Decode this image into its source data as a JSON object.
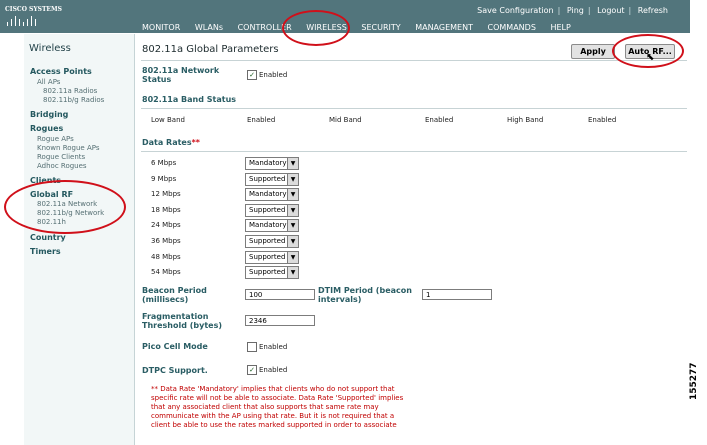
{
  "header": {
    "logo_text": "CISCO SYSTEMS",
    "util_links": [
      "Save Configuration",
      "Ping",
      "Logout",
      "Refresh"
    ],
    "nav": [
      "MONITOR",
      "WLANs",
      "CONTROLLER",
      "WIRELESS",
      "SECURITY",
      "MANAGEMENT",
      "COMMANDS",
      "HELP"
    ]
  },
  "sidebar": {
    "title": "Wireless",
    "access_points": "Access Points",
    "all_aps": "All APs",
    "radios_a": "802.11a Radios",
    "radios_bg": "802.11b/g Radios",
    "bridging": "Bridging",
    "rogues": "Rogues",
    "rogue_aps": "Rogue APs",
    "known_rogue_aps": "Known Rogue APs",
    "rogue_clients": "Rogue Clients",
    "adhoc_rogues": "Adhoc Rogues",
    "clients": "Clients",
    "global_rf": "Global RF",
    "net_a": "802.11a Network",
    "net_bg": "802.11b/g Network",
    "net_h": "802.11h",
    "country": "Country",
    "timers": "Timers"
  },
  "main": {
    "title": "802.11a Global Parameters",
    "apply": "Apply",
    "auto_rf": "Auto RF...",
    "network_status_label": "802.11a Network Status",
    "network_status_enabled": "Enabled",
    "band_status_label": "802.11a Band Status",
    "low_band": "Low Band",
    "low_band_val": "Enabled",
    "mid_band": "Mid Band",
    "mid_band_val": "Enabled",
    "high_band": "High Band",
    "high_band_val": "Enabled",
    "data_rates_label": "Data Rates",
    "data_rates_mark": "**",
    "rates": [
      {
        "rate": "6 Mbps",
        "value": "Mandatory"
      },
      {
        "rate": "9 Mbps",
        "value": "Supported"
      },
      {
        "rate": "12 Mbps",
        "value": "Mandatory"
      },
      {
        "rate": "18 Mbps",
        "value": "Supported"
      },
      {
        "rate": "24 Mbps",
        "value": "Mandatory"
      },
      {
        "rate": "36 Mbps",
        "value": "Supported"
      },
      {
        "rate": "48 Mbps",
        "value": "Supported"
      },
      {
        "rate": "54 Mbps",
        "value": "Supported"
      }
    ],
    "beacon_label": "Beacon Period (millisecs)",
    "beacon_value": "100",
    "dtim_label": "DTIM Period (beacon intervals)",
    "dtim_value": "1",
    "frag_label": "Fragmentation Threshold (bytes)",
    "frag_value": "2346",
    "pico_label": "Pico Cell Mode",
    "pico_enabled": "Enabled",
    "dtpc_label": "DTPC Support.",
    "dtpc_enabled": "Enabled",
    "note": "** Data Rate 'Mandatory' implies that clients who do not support that specific rate will not be able to associate. Data Rate 'Supported' implies that any associated client that also supports that same rate may communicate with the AP using that rate. But it is not required that a client be able to use the rates marked supported in order to associate"
  },
  "figure_number": "155277",
  "colors": {
    "header": "#52757c",
    "accent": "#2a5d64",
    "annotation": "#d0101a"
  }
}
